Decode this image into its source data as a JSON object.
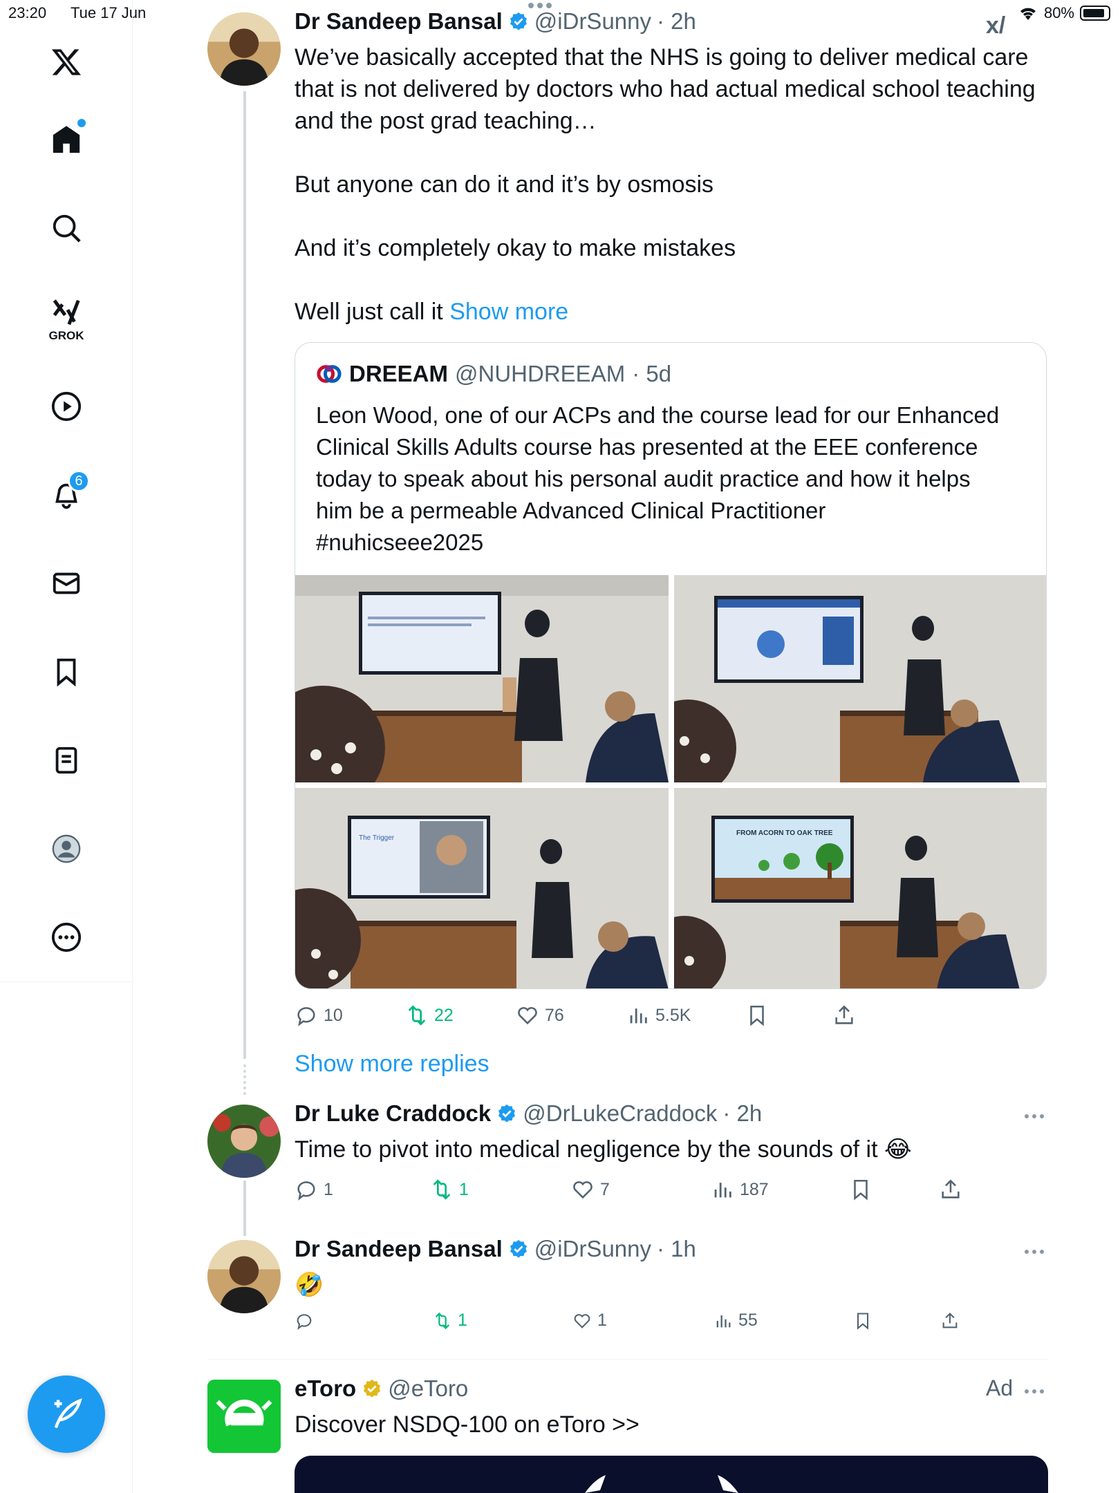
{
  "status_bar": {
    "time": "23:20",
    "date": "Tue 17 Jun",
    "battery": "80%"
  },
  "sidebar": {
    "items": [
      {
        "name": "home",
        "icon": "home-icon"
      },
      {
        "name": "search",
        "icon": "search-icon"
      },
      {
        "name": "grok",
        "icon": "grok-icon",
        "label": "GROK"
      },
      {
        "name": "video",
        "icon": "play-icon"
      },
      {
        "name": "notifications",
        "icon": "bell-icon",
        "badge": "6"
      },
      {
        "name": "messages",
        "icon": "mail-icon"
      },
      {
        "name": "bookmarks",
        "icon": "bookmark-icon"
      },
      {
        "name": "lists",
        "icon": "list-icon"
      },
      {
        "name": "profile",
        "icon": "profile-icon"
      },
      {
        "name": "more",
        "icon": "more-icon"
      }
    ],
    "compose_icon": "compose-icon"
  },
  "tweet_main": {
    "name": "Dr Sandeep Bansal",
    "handle": "@iDrSunny",
    "time": "· 2h",
    "text_lines": [
      "We’ve basically accepted that the NHS is going to deliver medical care",
      "that is not delivered by doctors who had actual medical school teaching",
      "and the post grad teaching…",
      "But anyone can do it and it’s by osmosis",
      "And it’s completely okay to make mistakes",
      "Well just call it"
    ],
    "show_more": "Show more",
    "quote": {
      "name": "DREEAM",
      "handle": "@NUHDREEAM",
      "time": "· 5d",
      "text_lines": [
        "Leon Wood, one of our ACPs and the course lead for our Enhanced",
        "Clinical Skills Adults course has presented at the EEE conference",
        "today to speak about his personal audit practice and how it helps",
        "him be a permeable Advanced Clinical Practitioner",
        "#nuhicseee2025"
      ],
      "slide_title": "FROM ACORN TO OAK TREE",
      "slide_heading": "The Trigger"
    },
    "stats": {
      "replies": "10",
      "reposts": "22",
      "likes": "76",
      "views": "5.5K"
    }
  },
  "show_more_replies": "Show more replies",
  "reply_1": {
    "name": "Dr Luke Craddock",
    "handle": "@DrLukeCraddock",
    "time": "· 2h",
    "text": "Time to pivot into medical negligence by the sounds of it 😂",
    "stats": {
      "replies": "1",
      "reposts": "1",
      "likes": "7",
      "views": "187"
    }
  },
  "reply_2": {
    "name": "Dr Sandeep Bansal",
    "handle": "@iDrSunny",
    "time": "· 1h",
    "text": "🤣",
    "stats": {
      "replies": "",
      "reposts": "1",
      "likes": "1",
      "views": "55"
    }
  },
  "ad": {
    "name": "eToro",
    "handle": "@eToro",
    "label": "Ad",
    "text": "Discover NSDQ-100 on eToro >>",
    "colors": {
      "brand": "#13c636"
    }
  },
  "colors": {
    "accent": "#1d9bf0",
    "repost": "#00ba7c",
    "muted": "#536471",
    "verified_gold": "#e2b719"
  }
}
